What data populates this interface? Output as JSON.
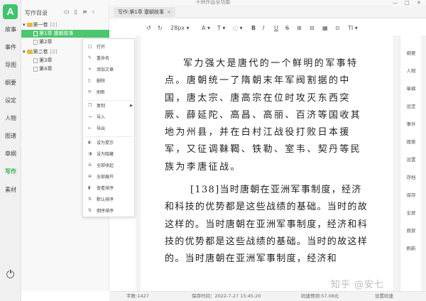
{
  "app": {
    "title": "不例作品全功能",
    "logo": "A"
  },
  "window_controls": [
    "—",
    "□",
    "✕"
  ],
  "rail": {
    "items": [
      {
        "label": "故事",
        "active": false
      },
      {
        "label": "事件",
        "active": false
      },
      {
        "label": "导图",
        "active": false
      },
      {
        "label": "纲要",
        "active": false
      },
      {
        "label": "设定",
        "active": false
      },
      {
        "label": "人物",
        "active": false
      },
      {
        "label": "图谱",
        "active": false
      },
      {
        "label": "章纲",
        "active": false
      },
      {
        "label": "写作",
        "active": true
      },
      {
        "label": "素材",
        "active": false
      }
    ]
  },
  "outline": {
    "title": "写作目录",
    "icons": [
      "folder-add-icon",
      "doc-add-icon",
      "list-icon",
      "collapse-icon"
    ],
    "icon_glyphs": [
      "▭",
      "▯",
      "≡",
      "‹"
    ],
    "nodes": [
      {
        "type": "volume",
        "label": "第一卷",
        "count": "[2]"
      },
      {
        "type": "chapter",
        "label": "第1章 塞朝故事",
        "selected": true
      },
      {
        "type": "chapter",
        "label": "第2章",
        "selected": false
      },
      {
        "type": "volume",
        "label": "第二卷",
        "count": "[2]"
      },
      {
        "type": "chapter",
        "label": "第3章",
        "selected": false
      },
      {
        "type": "chapter",
        "label": "第4章",
        "selected": false
      }
    ]
  },
  "context_menu": {
    "items": [
      {
        "label": "打开",
        "icon": "□"
      },
      {
        "label": "重命名",
        "icon": "✎"
      },
      {
        "label": "添加文章",
        "icon": "+"
      },
      {
        "label": "删除",
        "icon": "▯"
      },
      {
        "label": "刷新",
        "icon": "⟳"
      },
      {
        "label": "复制",
        "icon": "❐",
        "submenu": true
      },
      {
        "label": "导入",
        "icon": "→"
      },
      {
        "label": "导出",
        "icon": "←"
      },
      {
        "label": "设为提示",
        "icon": "◐"
      },
      {
        "label": "设为隐藏",
        "icon": "◑"
      },
      {
        "label": "全部收起",
        "icon": "⊖"
      },
      {
        "label": "全部展开",
        "icon": "⊕"
      },
      {
        "label": "查看排序",
        "icon": "▮"
      },
      {
        "label": "默认排序",
        "icon": "⇅"
      },
      {
        "label": "倒序排序",
        "icon": "⇅"
      }
    ]
  },
  "tab": {
    "label": "写作:第1章 塞朝故事",
    "close": "×"
  },
  "toolbar": {
    "items": [
      "↺",
      "↻",
      "28px ▾",
      "A ▾",
      "T ▾",
      "◌ ▾",
      "B",
      "I",
      "U",
      "S",
      "⊞",
      "⊟",
      "▦",
      "⊙",
      "TI ▾"
    ]
  },
  "editor": {
    "paragraphs": [
      "军力强大是唐代的一个鲜明的军事特点。唐朝统一了隋朝末年军阀割据的中国，唐太宗、唐高宗在位时攻灭东西突厥、薛延陀、高昌、高丽、百济等国收其地为州县，并在白村江战役打败日本援军，又征调靺鞨、铁勒、室韦、契丹等民族为李唐征战。",
      "[138]当时唐朝在亚洲军事制度，经济和科技的优势都是这些战绩的基础。当时的故这样的。当时唐朝在亚洲军事制度，经济和科技的优势都是这些战绩的基础。当时的故这样的。当时唐朝在亚洲军事制度，经济和"
    ],
    "watermark": "知乎 @安七"
  },
  "right_sidebar": {
    "items": [
      "纲要",
      "人物",
      "章纲",
      "设定",
      "事件",
      "搜索",
      "设置",
      "存档",
      "保存",
      "全屏",
      "原屏",
      "刷新"
    ]
  },
  "status": {
    "wordcount": "字数:1427",
    "saved": "保存时间：2022-7-27 15:45:20",
    "rate": "码速预测:57.08元",
    "settings": "设置码速"
  }
}
